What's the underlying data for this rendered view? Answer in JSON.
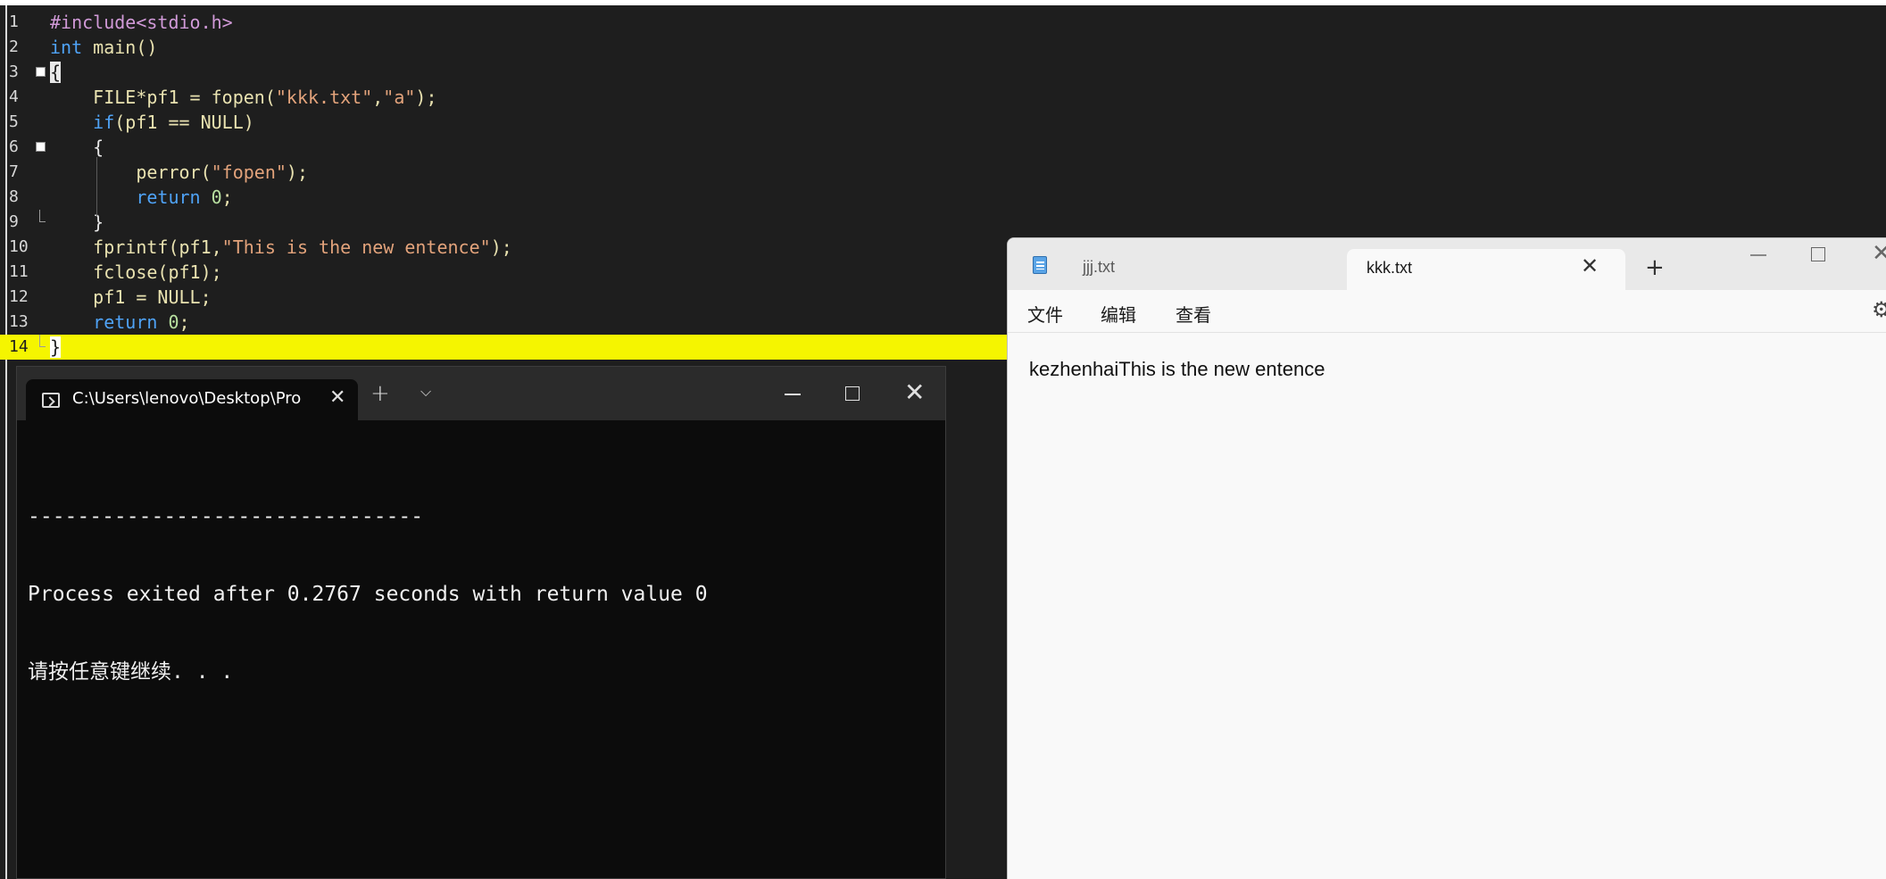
{
  "editor": {
    "lines": [
      {
        "n": "1",
        "parts": [
          {
            "t": "#include<stdio.h>",
            "c": "pp"
          }
        ]
      },
      {
        "n": "2",
        "parts": [
          {
            "t": "int",
            "c": "kw"
          },
          {
            "t": " main()",
            "c": "fn"
          }
        ]
      },
      {
        "n": "3",
        "fold": "open",
        "parts": [
          {
            "t": "{",
            "c": "brace"
          }
        ]
      },
      {
        "n": "4",
        "parts": [
          {
            "t": "    FILE*pf1 = fopen(",
            "c": "fn"
          },
          {
            "t": "\"kkk.txt\"",
            "c": "str"
          },
          {
            "t": ",",
            "c": "fn"
          },
          {
            "t": "\"a\"",
            "c": "str"
          },
          {
            "t": ");",
            "c": "fn"
          }
        ]
      },
      {
        "n": "5",
        "parts": [
          {
            "t": "    ",
            "c": "id"
          },
          {
            "t": "if",
            "c": "kw"
          },
          {
            "t": "(pf1 == NULL)",
            "c": "fn"
          }
        ]
      },
      {
        "n": "6",
        "fold": "open",
        "parts": [
          {
            "t": "    {",
            "c": "id"
          }
        ]
      },
      {
        "n": "7",
        "parts": [
          {
            "t": "        perror(",
            "c": "fn"
          },
          {
            "t": "\"fopen\"",
            "c": "str"
          },
          {
            "t": ");",
            "c": "fn"
          }
        ]
      },
      {
        "n": "8",
        "parts": [
          {
            "t": "        ",
            "c": "id"
          },
          {
            "t": "return",
            "c": "kw"
          },
          {
            "t": " ",
            "c": "id"
          },
          {
            "t": "0",
            "c": "num"
          },
          {
            "t": ";",
            "c": "fn"
          }
        ]
      },
      {
        "n": "9",
        "fold": "end",
        "parts": [
          {
            "t": "    }",
            "c": "id"
          }
        ]
      },
      {
        "n": "10",
        "parts": [
          {
            "t": "    fprintf(pf1,",
            "c": "fn"
          },
          {
            "t": "\"This is the new entence\"",
            "c": "str"
          },
          {
            "t": ");",
            "c": "fn"
          }
        ]
      },
      {
        "n": "11",
        "parts": [
          {
            "t": "    fclose(pf1);",
            "c": "fn"
          }
        ]
      },
      {
        "n": "12",
        "parts": [
          {
            "t": "    pf1 = NULL;",
            "c": "fn"
          }
        ]
      },
      {
        "n": "13",
        "parts": [
          {
            "t": "    ",
            "c": "id"
          },
          {
            "t": "return",
            "c": "kw"
          },
          {
            "t": " ",
            "c": "id"
          },
          {
            "t": "0",
            "c": "num"
          },
          {
            "t": ";",
            "c": "fn"
          }
        ]
      },
      {
        "n": "14",
        "fold": "end",
        "highlight": true,
        "parts": [
          {
            "t": "}",
            "c": "brace"
          }
        ]
      }
    ]
  },
  "console": {
    "tab_title": "C:\\Users\\lenovo\\Desktop\\Pro",
    "output": [
      "--------------------------------",
      "Process exited after 0.2767 seconds with return value 0",
      "请按任意键继续. . ."
    ]
  },
  "notepad": {
    "tab1_label": "jjj.txt",
    "tab2_label": "kkk.txt",
    "menu": {
      "file": "文件",
      "edit": "编辑",
      "view": "查看"
    },
    "content": "kezhenhaiThis is the new entence"
  },
  "glyphs": {
    "close": "✕",
    "plus": "+",
    "chevron": "⌵",
    "gear": "⚙"
  },
  "colors": {
    "line_highlight": "#f5f500",
    "editor_bg": "#1e1e1e",
    "console_bg": "#0c0c0c",
    "notepad_bg": "#f9f9f9"
  }
}
